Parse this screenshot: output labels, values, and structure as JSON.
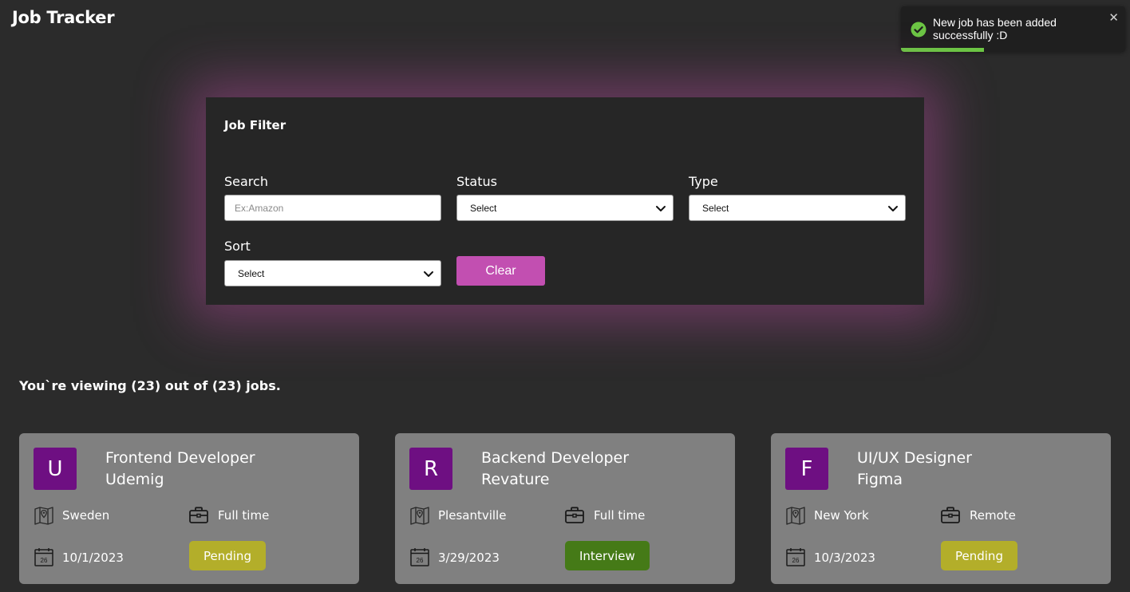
{
  "app": {
    "title": "Job Tracker"
  },
  "toast": {
    "message": "New job has been added successfully :D",
    "close": "✕",
    "progress": 0.37,
    "accent": "#6cc644"
  },
  "filter": {
    "title": "Job Filter",
    "search": {
      "label": "Search",
      "placeholder": "Ex:Amazon",
      "value": ""
    },
    "status": {
      "label": "Status",
      "value": "Select"
    },
    "type": {
      "label": "Type",
      "value": "Select"
    },
    "sort": {
      "label": "Sort",
      "value": "Select"
    },
    "clear_label": "Clear"
  },
  "summary": "You`re viewing (23) out of (23) jobs.",
  "jobs": [
    {
      "initial": "U",
      "position": "Frontend Developer",
      "company": "Udemig",
      "location": "Sweden",
      "type": "Full time",
      "date": "10/1/2023",
      "status": "Pending",
      "status_color": "#b3ae2a",
      "calendar_day": "26"
    },
    {
      "initial": "R",
      "position": "Backend Developer",
      "company": "Revature",
      "location": "Plesantville",
      "type": "Full time",
      "date": "3/29/2023",
      "status": "Interview",
      "status_color": "#457a17",
      "calendar_day": "26"
    },
    {
      "initial": "F",
      "position": "UI/UX Designer",
      "company": "Figma",
      "location": "New York",
      "type": "Remote",
      "date": "10/3/2023",
      "status": "Pending",
      "status_color": "#b3ae2a",
      "calendar_day": "26"
    }
  ],
  "colors": {
    "background": "#2b2b2b",
    "panel": "#262626",
    "glow": "#b74ca0",
    "accent_button": "#c24fb1",
    "card": "#808080",
    "avatar": "#6e0f82"
  },
  "icons": {
    "toast": "check-circle-icon",
    "location": "map-icon",
    "job_type": "briefcase-icon",
    "date": "calendar-icon",
    "select": "chevron-down-icon"
  }
}
